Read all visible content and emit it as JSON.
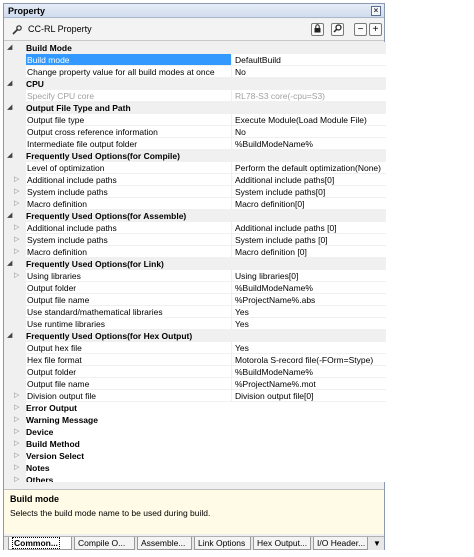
{
  "window": {
    "title": "Property",
    "close": "×"
  },
  "toolbar": {
    "title": "CC-RL Property",
    "lock": "🔒",
    "search": "🔍",
    "collapse": "−",
    "expand": "+"
  },
  "rows": [
    {
      "type": "cat",
      "label": "Build Mode",
      "state": "open"
    },
    {
      "type": "prop",
      "name": "Build mode",
      "value": "DefaultBuild",
      "selected": true
    },
    {
      "type": "prop",
      "name": "Change property value for all build modes at once",
      "value": "No"
    },
    {
      "type": "cat",
      "label": "CPU",
      "state": "open"
    },
    {
      "type": "prop",
      "name": "Specify CPU core",
      "value": "RL78-S3 core(-cpu=S3)",
      "disabled": true
    },
    {
      "type": "cat",
      "label": "Output File Type and Path",
      "state": "open"
    },
    {
      "type": "prop",
      "name": "Output file type",
      "value": "Execute Module(Load Module File)"
    },
    {
      "type": "prop",
      "name": "Output cross reference information",
      "value": "No"
    },
    {
      "type": "prop",
      "name": "Intermediate file output folder",
      "value": "%BuildModeName%"
    },
    {
      "type": "cat",
      "label": "Frequently Used Options(for Compile)",
      "state": "open"
    },
    {
      "type": "prop",
      "name": "Level of optimization",
      "value": "Perform the default optimization(None)"
    },
    {
      "type": "prop",
      "name": "Additional include paths",
      "value": "Additional include paths[0]",
      "expand": true
    },
    {
      "type": "prop",
      "name": "System include paths",
      "value": "System include paths[0]",
      "expand": true
    },
    {
      "type": "prop",
      "name": "Macro definition",
      "value": "Macro definition[0]",
      "expand": true
    },
    {
      "type": "cat",
      "label": "Frequently Used Options(for Assemble)",
      "state": "open"
    },
    {
      "type": "prop",
      "name": "Additional include paths",
      "value": "Additional include paths [0]",
      "expand": true
    },
    {
      "type": "prop",
      "name": "System include paths",
      "value": "System include paths [0]",
      "expand": true
    },
    {
      "type": "prop",
      "name": "Macro definition",
      "value": "Macro definition [0]",
      "expand": true
    },
    {
      "type": "cat",
      "label": "Frequently Used Options(for Link)",
      "state": "open"
    },
    {
      "type": "prop",
      "name": "Using libraries",
      "value": "Using libraries[0]",
      "expand": true
    },
    {
      "type": "prop",
      "name": "Output folder",
      "value": "%BuildModeName%"
    },
    {
      "type": "prop",
      "name": "Output file name",
      "value": "%ProjectName%.abs"
    },
    {
      "type": "prop",
      "name": "Use standard/mathematical libraries",
      "value": "Yes"
    },
    {
      "type": "prop",
      "name": "Use runtime libraries",
      "value": "Yes"
    },
    {
      "type": "cat",
      "label": "Frequently Used Options(for Hex Output)",
      "state": "open"
    },
    {
      "type": "prop",
      "name": "Output hex file",
      "value": "Yes"
    },
    {
      "type": "prop",
      "name": "Hex file format",
      "value": "Motorola S-record file(-FOrm=Stype)"
    },
    {
      "type": "prop",
      "name": "Output folder",
      "value": "%BuildModeName%"
    },
    {
      "type": "prop",
      "name": "Output file name",
      "value": "%ProjectName%.mot"
    },
    {
      "type": "prop",
      "name": "Division output file",
      "value": "Division output file[0]",
      "expand": true
    },
    {
      "type": "cat",
      "label": "Error Output",
      "state": "closed"
    },
    {
      "type": "cat",
      "label": "Warning Message",
      "state": "closed"
    },
    {
      "type": "cat",
      "label": "Device",
      "state": "closed"
    },
    {
      "type": "cat",
      "label": "Build Method",
      "state": "closed"
    },
    {
      "type": "cat",
      "label": "Version Select",
      "state": "closed"
    },
    {
      "type": "cat",
      "label": "Notes",
      "state": "closed"
    },
    {
      "type": "cat",
      "label": "Others",
      "state": "closed"
    }
  ],
  "description": {
    "title": "Build mode",
    "text": "Selects the build mode name to be used during build."
  },
  "tabs": [
    "Common...",
    "Compile O...",
    "Assemble...",
    "Link Options",
    "Hex Output...",
    "I/O Header..."
  ],
  "tabs_menu": "▼"
}
